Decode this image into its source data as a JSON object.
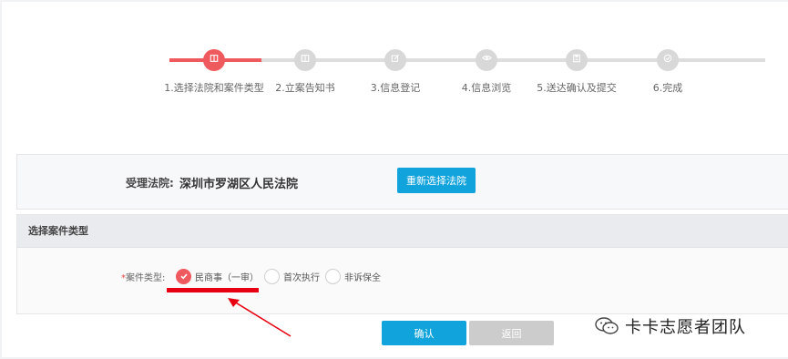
{
  "stepper": {
    "steps": [
      {
        "label": "1.选择法院和案件类型",
        "icon": "book-icon",
        "active": true
      },
      {
        "label": "2.立案告知书",
        "icon": "book-icon",
        "active": false
      },
      {
        "label": "3.信息登记",
        "icon": "edit-icon",
        "active": false
      },
      {
        "label": "4.信息浏览",
        "icon": "eye-icon",
        "active": false
      },
      {
        "label": "5.送达确认及提交",
        "icon": "save-icon",
        "active": false
      },
      {
        "label": "6.完成",
        "icon": "check-icon",
        "active": false
      }
    ],
    "active_color": "#ef5a5f",
    "inactive_color": "#d8d8d8"
  },
  "court": {
    "label": "受理法院:",
    "name": "深圳市罗湖区人民法院",
    "reselect_button": "重新选择法院"
  },
  "case_type": {
    "header": "选择案件类型",
    "required_mark": "*",
    "field_label": "案件类型:",
    "options": [
      {
        "label": "民商事（一审）",
        "checked": true
      },
      {
        "label": "首次执行",
        "checked": false
      },
      {
        "label": "非诉保全",
        "checked": false
      }
    ]
  },
  "actions": {
    "confirm": "确认",
    "back": "返回"
  },
  "watermark": {
    "text": "卡卡志愿者团队",
    "icon": "wechat-icon"
  },
  "colors": {
    "accent": "#11a3dc",
    "active_red": "#ef5a5f",
    "annotation_red": "#e60012"
  }
}
